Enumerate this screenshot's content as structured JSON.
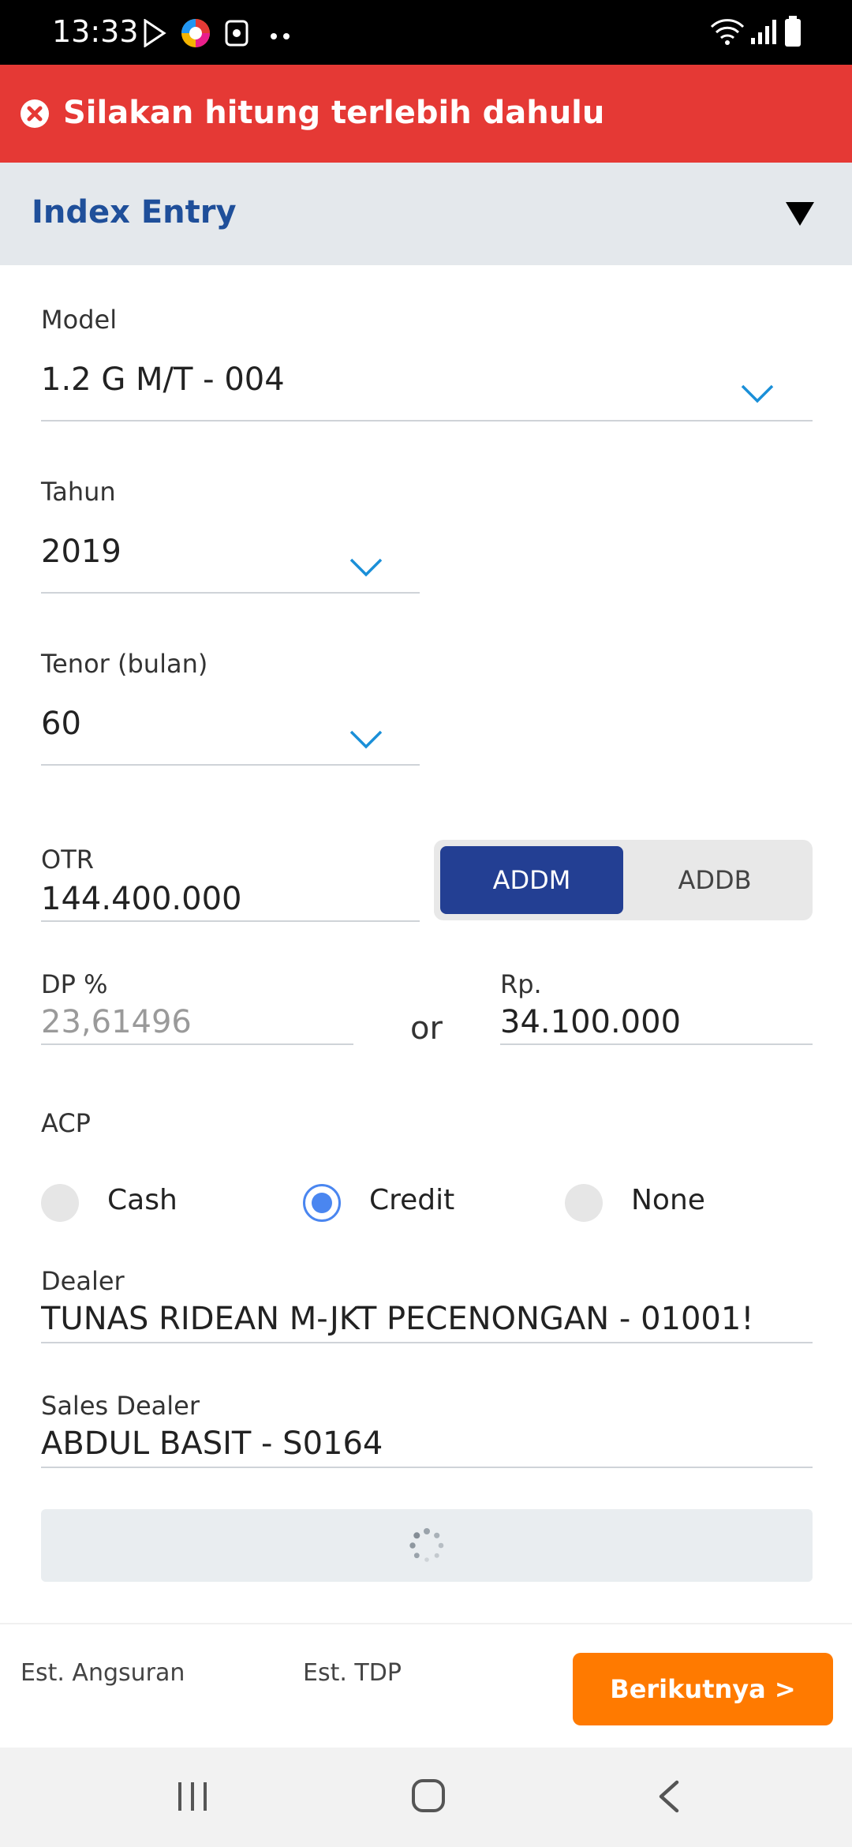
{
  "status_bar": {
    "time": "13:33",
    "icons": [
      "play-store-icon",
      "app-icon",
      "screen-record-icon",
      "more-dots-icon",
      "wifi-icon",
      "signal-icon",
      "battery-icon"
    ]
  },
  "error_banner": {
    "message": "Silakan hitung terlebih dahulu",
    "icon": "error-circle-icon",
    "color": "#e53935"
  },
  "section": {
    "title": "Index Entry",
    "title_color": "#1f4f9a"
  },
  "form": {
    "model": {
      "label": "Model",
      "value": "1.2 G M/T - 004"
    },
    "tahun": {
      "label": "Tahun",
      "value": "2019"
    },
    "tenor": {
      "label": "Tenor (bulan)",
      "value": "60"
    },
    "otr": {
      "label": "OTR",
      "value": "144.400.000"
    },
    "toggle": {
      "options": [
        "ADDM",
        "ADDB"
      ],
      "selected": "ADDM",
      "active_color": "#233f93"
    },
    "dp_percent": {
      "label": "DP %",
      "value": "23,61496"
    },
    "or_text": "or",
    "dp_rp": {
      "label": "Rp.",
      "value": "34.100.000"
    },
    "acp": {
      "label": "ACP",
      "options": [
        "Cash",
        "Credit",
        "None"
      ],
      "selected": "Credit"
    },
    "dealer": {
      "label": "Dealer",
      "value": "TUNAS RIDEAN M-JKT PECENONGAN - 01001!"
    },
    "sales_dealer": {
      "label": "Sales Dealer",
      "value": "ABDUL BASIT - S0164"
    }
  },
  "bottom": {
    "est_angsuran": "Est. Angsuran",
    "est_tdp": "Est. TDP",
    "next_button": "Berikutnya >",
    "next_color": "#ff7a00"
  }
}
